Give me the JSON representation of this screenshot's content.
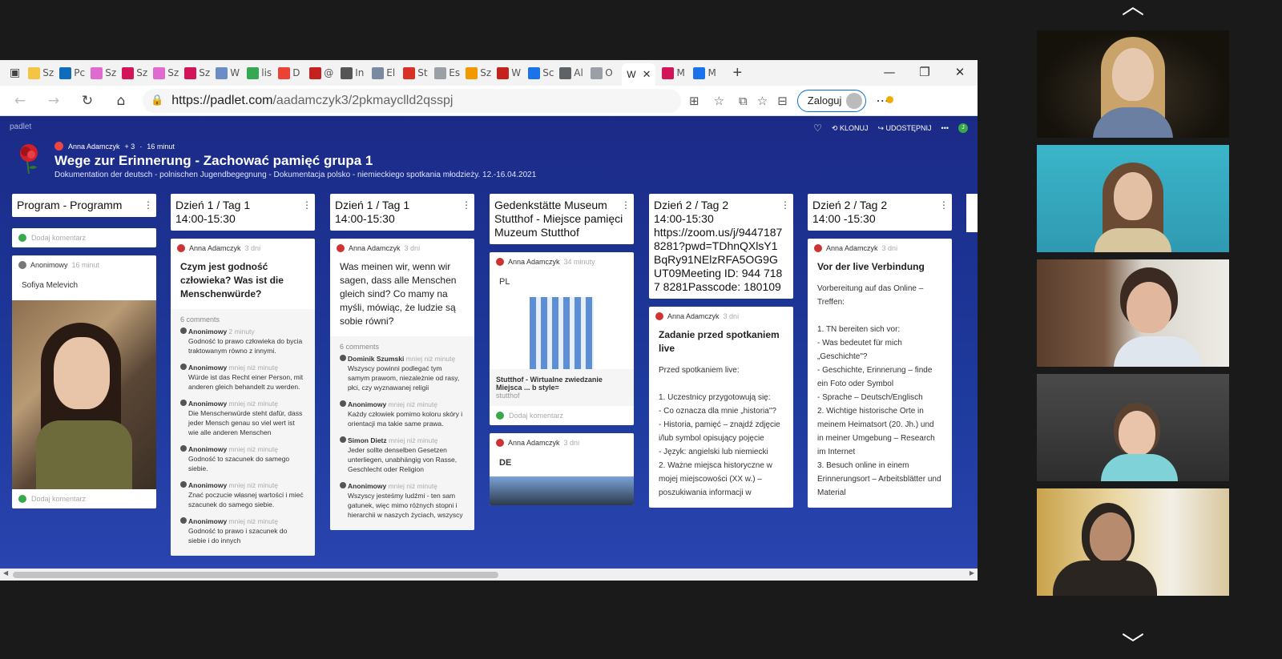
{
  "tabs": [
    {
      "label": "Sz",
      "color": "#f4c542"
    },
    {
      "label": "Pc",
      "color": "#0f6cbd"
    },
    {
      "label": "Sz",
      "color": "#e06bd0"
    },
    {
      "label": "Sz",
      "color": "#d4145a"
    },
    {
      "label": "Sz",
      "color": "#e06bd0"
    },
    {
      "label": "Sz",
      "color": "#d4145a"
    },
    {
      "label": "W",
      "color": "#6b8cc7"
    },
    {
      "label": "lis",
      "color": "#34a853"
    },
    {
      "label": "D",
      "color": "#ea4335"
    },
    {
      "label": "@",
      "color": "#c5221f"
    },
    {
      "label": "In",
      "color": "#555555"
    },
    {
      "label": "El",
      "color": "#7a8aa0"
    },
    {
      "label": "St",
      "color": "#d93025"
    },
    {
      "label": "Es",
      "color": "#9aa0a6"
    },
    {
      "label": "Sz",
      "color": "#f29900"
    },
    {
      "label": "W",
      "color": "#c5221f"
    },
    {
      "label": "Sc",
      "color": "#1a73e8"
    },
    {
      "label": "Al",
      "color": "#5f6368"
    },
    {
      "label": "O",
      "color": "#9aa0a6"
    }
  ],
  "active_tab": {
    "label": "W",
    "close": "✕"
  },
  "tabs_after": [
    {
      "label": "M",
      "color": "#d4145a"
    },
    {
      "label": "M",
      "color": "#1a73e8"
    }
  ],
  "window": {
    "new_tab": "+",
    "minimize": "—",
    "restore": "❐",
    "close": "✕"
  },
  "address": {
    "host": "https://padlet.com",
    "path": "/aadamczyk3/2pkmayclld2qsspj",
    "login_label": "Zaloguj"
  },
  "padlet": {
    "brand": "padlet",
    "author": "Anna Adamczyk",
    "plus": "+ 3",
    "ago": "16 minut",
    "title": "Wege zur Erinnerung - Zachować pamięć grupa 1",
    "subtitle": "Dokumentation der deutsch - polnischen Jugendbegegnung - Dokumentacja polsko - niemieckiego spotkania młodzieży. 12.-16.04.2021",
    "actions": {
      "klonuj": "KLONUJ",
      "udostepnij": "UDOSTĘPNIJ",
      "more": "•••",
      "user": "J"
    }
  },
  "add_comment": "Dodaj komentarz",
  "columns": [
    {
      "header": "Program - Programm",
      "cards": [
        {
          "author": "Anonimowy",
          "ago": "16 minut",
          "body": "Sofiya Melevich"
        }
      ]
    },
    {
      "header": "Dzień 1 / Tag 1\n14:00-15:30",
      "cards": [
        {
          "author": "Anna Adamczyk",
          "ago": "3 dni",
          "title": "Czym jest godność człowieka? Was ist die Menschenwürde?",
          "comments_count": "6 comments",
          "comments": [
            {
              "name": "Anonimowy",
              "ago": "2 minuty",
              "text": "Godność to prawo człowieka do bycia traktowanym równo z innymi."
            },
            {
              "name": "Anonimowy",
              "ago": "mniej niż minutę",
              "text": "Würde ist das Recht einer Person, mit anderen gleich behandelt zu werden."
            },
            {
              "name": "Anonimowy",
              "ago": "mniej niż minutę",
              "text": "Die Menschenwürde steht dafür, dass jeder Mensch genau so viel wert ist wie alle anderen Menschen"
            },
            {
              "name": "Anonimowy",
              "ago": "mniej niż minutę",
              "text": "Godność to szacunek do samego siebie."
            },
            {
              "name": "Anonimowy",
              "ago": "mniej niż minutę",
              "text": "Znać poczucie własnej wartości i mieć szacunek do samego siebie."
            },
            {
              "name": "Anonimowy",
              "ago": "mniej niż minutę",
              "text": "Godność to prawo i szacunek do siebie i do innych"
            }
          ]
        }
      ]
    },
    {
      "header": "Dzień 1 / Tag 1\n14:00-15:30",
      "cards": [
        {
          "author": "Anna Adamczyk",
          "ago": "3 dni",
          "title": "Was meinen wir, wenn wir sagen, dass alle Menschen gleich sind? Co mamy na myśli, mówiąc, że ludzie są sobie równi?",
          "comments_count": "6 comments",
          "comments": [
            {
              "name": "Dominik Szumski",
              "ago": "mniej niż minutę",
              "text": "Wszyscy powinni podlegać tym samym prawom, niezależnie od rasy, płci, czy wyznawanej religii"
            },
            {
              "name": "Anonimowy",
              "ago": "mniej niż minutę",
              "text": "Każdy człowiek pomimo koloru skóry i orientacji ma takie same prawa."
            },
            {
              "name": "Simon Dietz",
              "ago": "mniej niż minutę",
              "text": "Jeder sollte denselben Gesetzen unterliegen, unabhängig von Rasse, Geschlecht oder Religion"
            },
            {
              "name": "Anonimowy",
              "ago": "mniej niż minutę",
              "text": "Wszyscy jesteśmy ludźmi - ten sam gatunek, więc mimo różnych stopni i hierarchii w naszych życiach, wszyscy"
            }
          ]
        }
      ]
    },
    {
      "header": "Gedenkstätte Museum Stutthof - Miejsce pamięci Muzeum Stutthof",
      "cards": [
        {
          "author": "Anna Adamczyk",
          "ago": "34 minuty",
          "body": "PL",
          "link_title": "Stutthof - Wirtualne zwiedzanie Miejsca ... b style=",
          "link_src": "stutthof"
        },
        {
          "author": "Anna Adamczyk",
          "ago": "3 dni",
          "body": "DE"
        }
      ]
    },
    {
      "header": "Dzień 2 / Tag 2\n14:00-15:30\nhttps://zoom.us/j/94471878281?pwd=TDhnQXlsY1BqRy91NElzRFA5OG9GUT09Meeting ID: 944 7187 8281Passcode: 180109",
      "cards": [
        {
          "author": "Anna Adamczyk",
          "ago": "3 dni",
          "title": "Zadanie przed spotkaniem live",
          "body": "Przed spotkaniem live:\n\n1.      Uczestnicy przygotowują się:\n-        Co oznacza dla mnie „historia\"?\n-        Historia, pamięć – znajdź zdjęcie i/lub symbol opisujący pojęcie\n-        Język: angielski lub niemiecki\n2.      Ważne miejsca historyczne w mojej miejscowości (XX w.) – poszukiwania informacji w"
        }
      ]
    },
    {
      "header": "Dzień 2 / Tag 2\n14:00 -15:30",
      "cards": [
        {
          "author": "Anna Adamczyk",
          "ago": "3 dni",
          "title": "Vor der live Verbindung",
          "body": "Vorbereitung auf das Online – Treffen:\n\n1.      TN bereiten sich vor:\n-        Was bedeutet für mich „Geschichte\"?\n-        Geschichte, Erinnerung – finde ein Foto oder Symbol\n-        Sprache – Deutsch/Englisch\n2.      Wichtige historische Orte in meinem Heimatsort (20. Jh.) und in meiner Umgebung – Research im Internet\n3.      Besuch online in einem Erinnerungsort – Arbeitsblätter und Material"
        }
      ]
    }
  ]
}
